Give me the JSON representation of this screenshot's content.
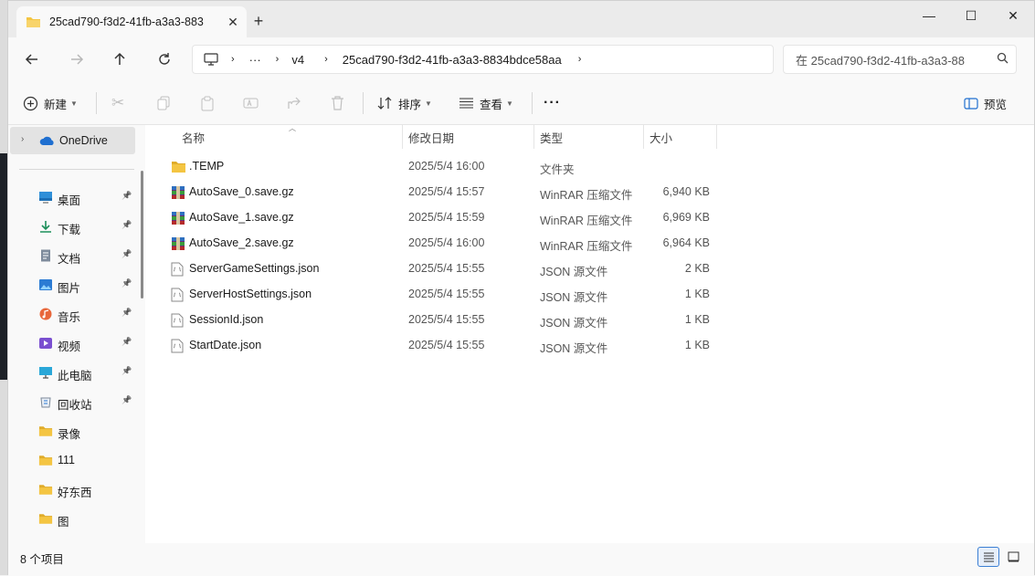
{
  "tab": {
    "title": "25cad790-f3d2-41fb-a3a3-883",
    "close": "✕",
    "new_tab": "+"
  },
  "window_controls": {
    "minimize": "—",
    "maximize": "☐",
    "close": "✕"
  },
  "breadcrumb": {
    "more": "···",
    "items": [
      "v4",
      "25cad790-f3d2-41fb-a3a3-8834bdce58aa"
    ]
  },
  "search": {
    "placeholder": "在 25cad790-f3d2-41fb-a3a3-88"
  },
  "toolbar": {
    "new_label": "新建",
    "sort_label": "排序",
    "view_label": "查看",
    "more": "···",
    "preview_label": "预览"
  },
  "sidebar": {
    "onedrive": "OneDrive",
    "items": [
      {
        "label": "桌面",
        "icon": "desktop-icon",
        "pinned": true
      },
      {
        "label": "下载",
        "icon": "download-icon",
        "pinned": true
      },
      {
        "label": "文档",
        "icon": "document-icon",
        "pinned": true
      },
      {
        "label": "图片",
        "icon": "pictures-icon",
        "pinned": true
      },
      {
        "label": "音乐",
        "icon": "music-icon",
        "pinned": true
      },
      {
        "label": "视频",
        "icon": "videos-icon",
        "pinned": true
      },
      {
        "label": "此电脑",
        "icon": "this-pc-icon",
        "pinned": true
      },
      {
        "label": "回收站",
        "icon": "recycle-bin-icon",
        "pinned": true
      },
      {
        "label": "录像",
        "icon": "folder-icon",
        "pinned": false
      },
      {
        "label": "111",
        "icon": "folder-icon",
        "pinned": false
      },
      {
        "label": "好东西",
        "icon": "folder-icon",
        "pinned": false
      },
      {
        "label": "图",
        "icon": "folder-icon",
        "pinned": false
      }
    ]
  },
  "columns": {
    "name": "名称",
    "date": "修改日期",
    "type": "类型",
    "size": "大小"
  },
  "files": [
    {
      "name": ".TEMP",
      "date": "2025/5/4 16:00",
      "type": "文件夹",
      "size": "",
      "icon": "folder"
    },
    {
      "name": "AutoSave_0.save.gz",
      "date": "2025/5/4 15:57",
      "type": "WinRAR 压缩文件",
      "size": "6,940 KB",
      "icon": "winrar"
    },
    {
      "name": "AutoSave_1.save.gz",
      "date": "2025/5/4 15:59",
      "type": "WinRAR 压缩文件",
      "size": "6,969 KB",
      "icon": "winrar"
    },
    {
      "name": "AutoSave_2.save.gz",
      "date": "2025/5/4 16:00",
      "type": "WinRAR 压缩文件",
      "size": "6,964 KB",
      "icon": "winrar"
    },
    {
      "name": "ServerGameSettings.json",
      "date": "2025/5/4 15:55",
      "type": "JSON 源文件",
      "size": "2 KB",
      "icon": "json"
    },
    {
      "name": "ServerHostSettings.json",
      "date": "2025/5/4 15:55",
      "type": "JSON 源文件",
      "size": "1 KB",
      "icon": "json"
    },
    {
      "name": "SessionId.json",
      "date": "2025/5/4 15:55",
      "type": "JSON 源文件",
      "size": "1 KB",
      "icon": "json"
    },
    {
      "name": "StartDate.json",
      "date": "2025/5/4 15:55",
      "type": "JSON 源文件",
      "size": "1 KB",
      "icon": "json"
    }
  ],
  "status": {
    "count": "8 个项目"
  },
  "colors": {
    "folder": "#f4c542",
    "accent": "#1f6fd0",
    "selected_bg": "#e3e3e3"
  }
}
